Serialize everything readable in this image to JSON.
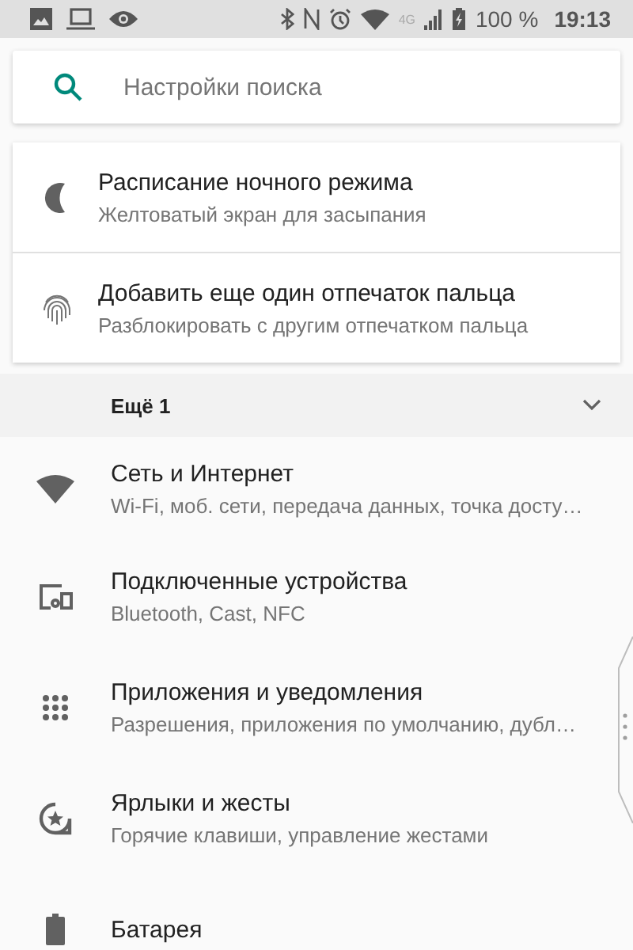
{
  "status_bar": {
    "network": "4G",
    "battery": "100 %",
    "time": "19:13"
  },
  "search": {
    "placeholder": "Настройки поиска"
  },
  "suggestions": [
    {
      "kind": "moon",
      "title": "Расписание ночного режима",
      "subtitle": "Желтоватый экран для засыпания"
    },
    {
      "kind": "fingerprint",
      "title": "Добавить еще один отпечаток пальца",
      "subtitle": "Разблокировать с другим отпечатком пальца"
    }
  ],
  "more": {
    "label": "Ещё 1",
    "expanded": false
  },
  "settings": [
    {
      "kind": "wifi",
      "title": "Сеть и Интернет",
      "subtitle": "Wi-Fi, моб. сети, передача данных, точка досту…"
    },
    {
      "kind": "devices",
      "title": "Подключенные устройства",
      "subtitle": "Bluetooth, Cast, NFC"
    },
    {
      "kind": "apps",
      "title": "Приложения и уведомления",
      "subtitle": "Разрешения, приложения по умолчанию, дубл…"
    },
    {
      "kind": "gestures",
      "title": "Ярлыки и жесты",
      "subtitle": "Горячие клавиши, управление жестами"
    },
    {
      "kind": "battery",
      "title": "Батарея"
    }
  ]
}
